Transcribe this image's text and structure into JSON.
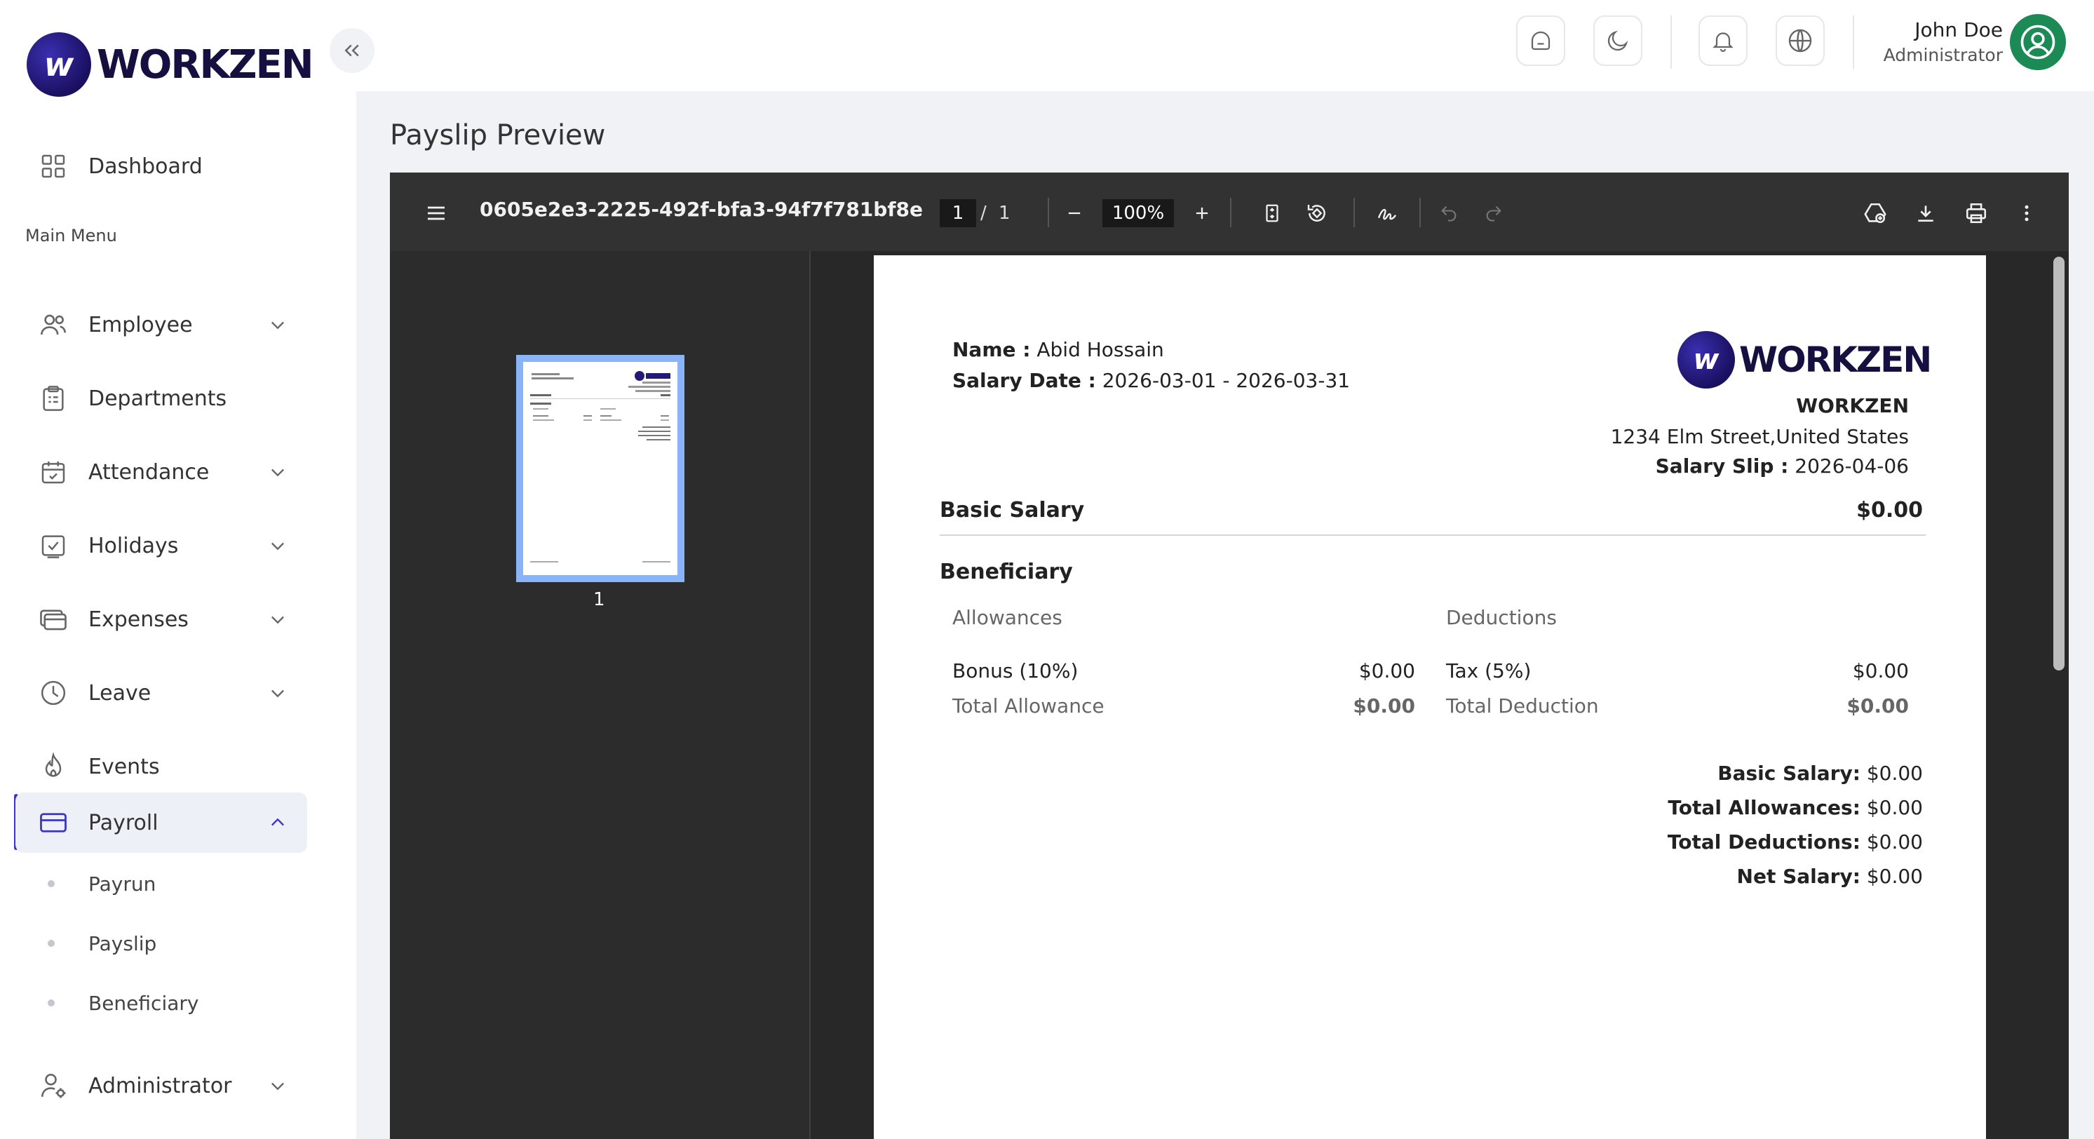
{
  "app": {
    "logo_text": "WORKZEN",
    "logo_mark": "w"
  },
  "sidebar": {
    "dashboard": "Dashboard",
    "section_title": "Main Menu",
    "items": [
      {
        "label": "Employee"
      },
      {
        "label": "Departments"
      },
      {
        "label": "Attendance"
      },
      {
        "label": "Holidays"
      },
      {
        "label": "Expenses"
      },
      {
        "label": "Leave"
      },
      {
        "label": "Events"
      },
      {
        "label": "Payroll"
      },
      {
        "label": "Administrator"
      }
    ],
    "payroll_sub": [
      {
        "label": "Payrun"
      },
      {
        "label": "Payslip"
      },
      {
        "label": "Beneficiary"
      }
    ]
  },
  "topbar": {
    "user_name": "John Doe",
    "user_role": "Administrator"
  },
  "page": {
    "title": "Payslip Preview"
  },
  "pdf": {
    "filename": "0605e2e3-2225-492f-bfa3-94f7f781bf8e",
    "current_page": "1",
    "page_sep": "/",
    "total_pages": "1",
    "zoom": "100%",
    "thumb_label": "1"
  },
  "payslip": {
    "name_label": "Name :",
    "name_value": "Abid Hossain",
    "salary_date_label": "Salary Date :",
    "salary_date_value": "2026-03-01 - 2026-03-31",
    "company_logo_text": "WORKZEN",
    "company_name": "WORKZEN",
    "company_address": "1234 Elm Street,United States",
    "slip_label": "Salary Slip :",
    "slip_date": "2026-04-06",
    "basic_salary_label": "Basic Salary",
    "basic_salary_value": "$0.00",
    "beneficiary_title": "Beneficiary",
    "allowances_header": "Allowances",
    "deductions_header": "Deductions",
    "allowance_item_label": "Bonus (10%)",
    "allowance_item_value": "$0.00",
    "total_allowance_label": "Total Allowance",
    "total_allowance_value": "$0.00",
    "deduction_item_label": "Tax (5%)",
    "deduction_item_value": "$0.00",
    "total_deduction_label": "Total Deduction",
    "total_deduction_value": "$0.00",
    "summary": {
      "basic_label": "Basic Salary:",
      "basic_value": "$0.00",
      "allowances_label": "Total Allowances:",
      "allowances_value": "$0.00",
      "deductions_label": "Total Deductions:",
      "deductions_value": "$0.00",
      "net_label": "Net Salary:",
      "net_value": "$0.00"
    }
  },
  "icons": {
    "accent": "#3b35c6",
    "avatar_bg": "#1c8a55"
  }
}
